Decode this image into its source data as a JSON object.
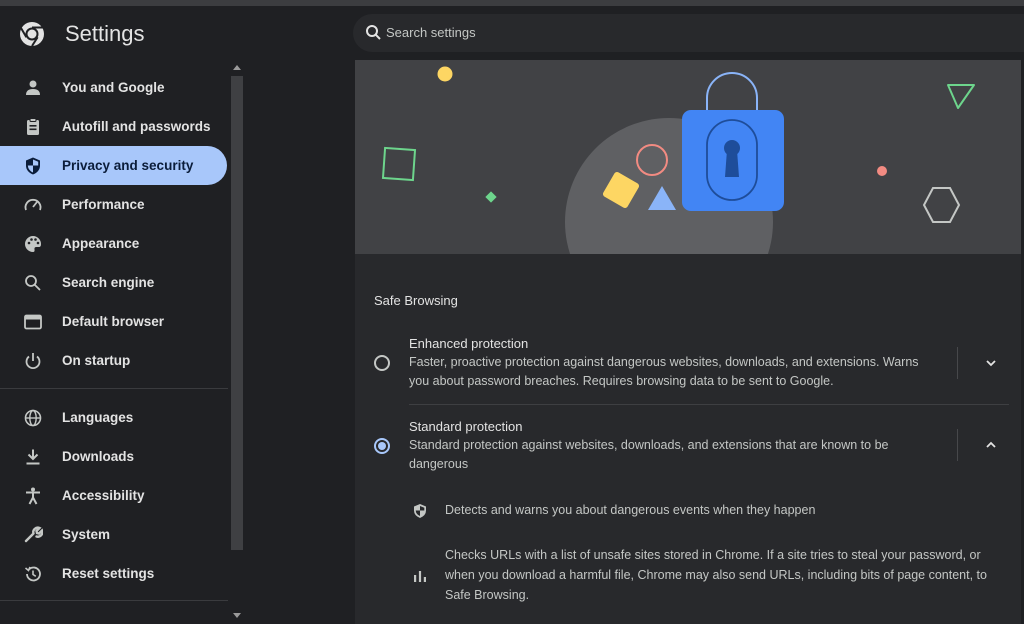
{
  "header": {
    "title": "Settings",
    "search_placeholder": "Search settings"
  },
  "sidebar": {
    "items": [
      {
        "label": "You and Google",
        "icon": "person-icon"
      },
      {
        "label": "Autofill and passwords",
        "icon": "clipboard-icon"
      },
      {
        "label": "Privacy and security",
        "icon": "shield-icon",
        "active": true
      },
      {
        "label": "Performance",
        "icon": "speedometer-icon"
      },
      {
        "label": "Appearance",
        "icon": "palette-icon"
      },
      {
        "label": "Search engine",
        "icon": "search-icon"
      },
      {
        "label": "Default browser",
        "icon": "browser-icon"
      },
      {
        "label": "On startup",
        "icon": "power-icon"
      },
      {
        "label": "Languages",
        "icon": "globe-icon"
      },
      {
        "label": "Downloads",
        "icon": "download-icon"
      },
      {
        "label": "Accessibility",
        "icon": "accessibility-icon"
      },
      {
        "label": "System",
        "icon": "wrench-icon"
      },
      {
        "label": "Reset settings",
        "icon": "history-icon"
      }
    ]
  },
  "safe_browsing": {
    "section_title": "Safe Browsing",
    "enhanced": {
      "title": "Enhanced protection",
      "description": "Faster, proactive protection against dangerous websites, downloads, and extensions. Warns you about password breaches. Requires browsing data to be sent to Google.",
      "selected": false,
      "expanded": false
    },
    "standard": {
      "title": "Standard protection",
      "description": "Standard protection against websites, downloads, and extensions that are known to be dangerous",
      "selected": true,
      "expanded": true,
      "details": [
        {
          "icon": "shield-icon",
          "text": "Detects and warns you about dangerous events when they happen"
        },
        {
          "icon": "bar-chart-icon",
          "text": "Checks URLs with a list of unsafe sites stored in Chrome. If a site tries to steal your password, or when you download a harmful file, Chrome may also send URLs, including bits of page content, to Safe Browsing."
        }
      ]
    }
  },
  "colors": {
    "accent": "#a8c7fa",
    "lock_blue": "#4285f4",
    "background": "#1f2023",
    "card": "#28292c"
  }
}
